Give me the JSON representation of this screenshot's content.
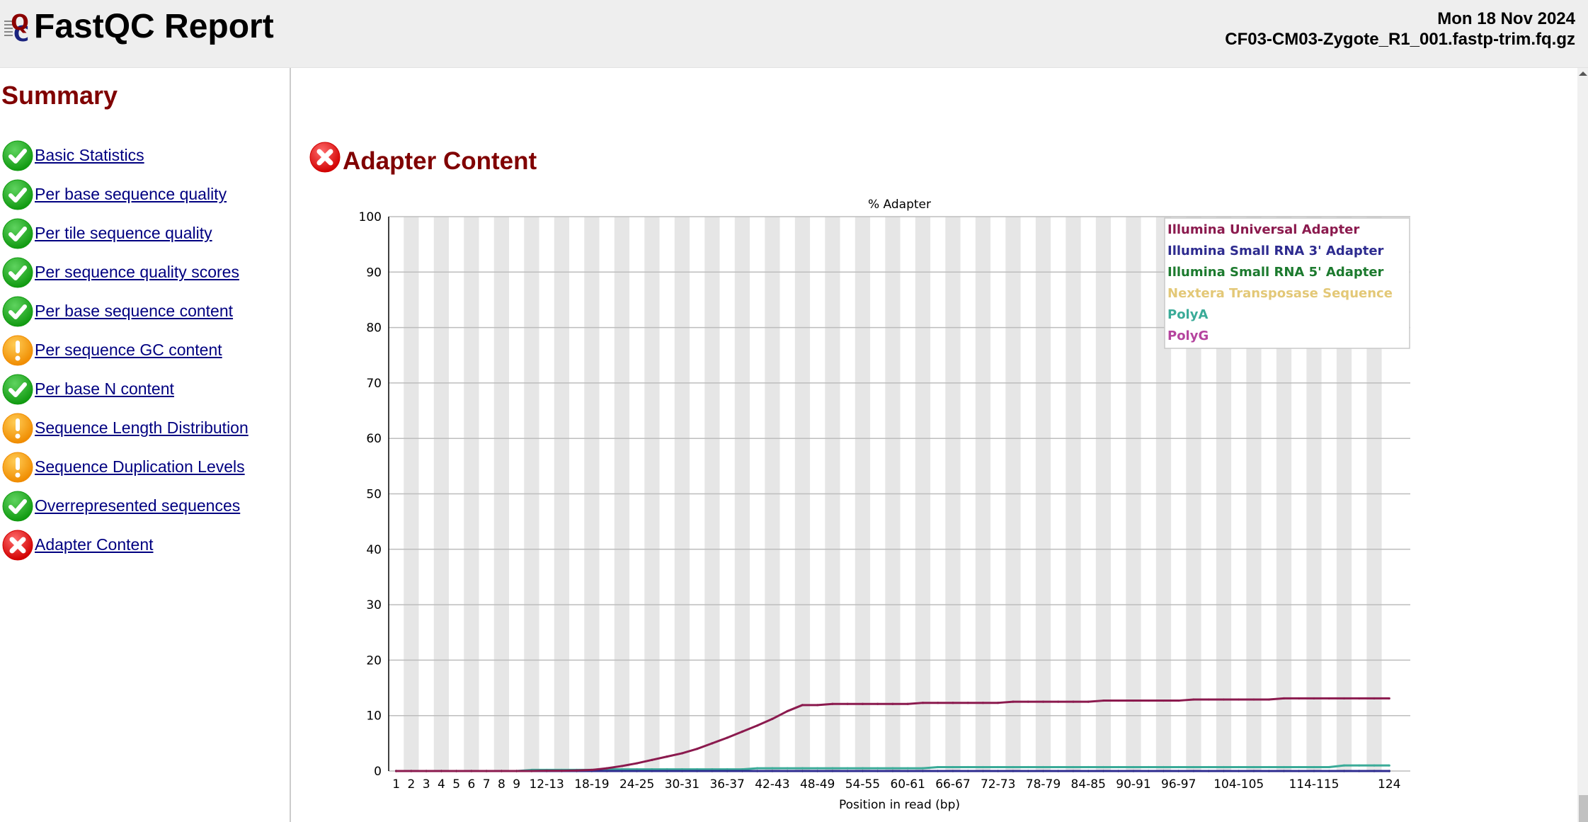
{
  "header": {
    "title": "FastQC Report",
    "date": "Mon 18 Nov 2024",
    "filename": "CF03-CM03-Zygote_R1_001.fastp-trim.fq.gz"
  },
  "sidebar": {
    "title": "Summary",
    "items": [
      {
        "label": "Basic Statistics",
        "status": "pass"
      },
      {
        "label": "Per base sequence quality",
        "status": "pass"
      },
      {
        "label": "Per tile sequence quality",
        "status": "pass"
      },
      {
        "label": "Per sequence quality scores",
        "status": "pass"
      },
      {
        "label": "Per base sequence content",
        "status": "pass"
      },
      {
        "label": "Per sequence GC content",
        "status": "warn"
      },
      {
        "label": "Per base N content",
        "status": "pass"
      },
      {
        "label": "Sequence Length Distribution",
        "status": "warn"
      },
      {
        "label": "Sequence Duplication Levels",
        "status": "warn"
      },
      {
        "label": "Overrepresented sequences",
        "status": "pass"
      },
      {
        "label": "Adapter Content",
        "status": "fail"
      }
    ]
  },
  "section": {
    "title": "Adapter Content",
    "status": "fail"
  },
  "colors": {
    "pass": "#1a9e1a",
    "warn": "#f39c12",
    "fail": "#e01818",
    "heading": "#800000",
    "link": "#000080"
  },
  "chart_data": {
    "type": "line",
    "title": "% Adapter",
    "xlabel": "Position in read (bp)",
    "ylabel": "",
    "ylim": [
      0,
      100
    ],
    "yticks": [
      0,
      10,
      20,
      30,
      40,
      50,
      60,
      70,
      80,
      90,
      100
    ],
    "grid": true,
    "legend_position": "top-right",
    "categories": [
      "1",
      "2",
      "3",
      "4",
      "5",
      "6",
      "7",
      "8",
      "9",
      "10-11",
      "12-13",
      "14-15",
      "16-17",
      "18-19",
      "20-21",
      "22-23",
      "24-25",
      "26-27",
      "28-29",
      "30-31",
      "32-33",
      "34-35",
      "36-37",
      "38-39",
      "40-41",
      "42-43",
      "44-45",
      "46-47",
      "48-49",
      "50-51",
      "52-53",
      "54-55",
      "56-57",
      "58-59",
      "60-61",
      "62-63",
      "64-65",
      "66-67",
      "68-69",
      "70-71",
      "72-73",
      "74-75",
      "76-77",
      "78-79",
      "80-81",
      "82-83",
      "84-85",
      "86-87",
      "88-89",
      "90-91",
      "92-93",
      "94-95",
      "96-97",
      "98-99",
      "100-101",
      "102-103",
      "104-105",
      "106-107",
      "108-109",
      "110-111",
      "112-113",
      "114-115",
      "116-117",
      "118-119",
      "120-121",
      "122-123",
      "124"
    ],
    "tick_labels": {
      "0": "1",
      "1": "2",
      "2": "3",
      "3": "4",
      "4": "5",
      "5": "6",
      "6": "7",
      "7": "8",
      "8": "9",
      "10": "12-13",
      "13": "18-19",
      "16": "24-25",
      "19": "30-31",
      "22": "36-37",
      "25": "42-43",
      "28": "48-49",
      "31": "54-55",
      "34": "60-61",
      "37": "66-67",
      "40": "72-73",
      "43": "78-79",
      "46": "84-85",
      "49": "90-91",
      "52": "96-97",
      "56": "104-105",
      "61": "114-115",
      "66": "124"
    },
    "series": [
      {
        "name": "Illumina Universal Adapter",
        "color": "#8b1a4e",
        "values": [
          0,
          0,
          0,
          0,
          0,
          0,
          0,
          0,
          0,
          0,
          0.05,
          0.05,
          0.1,
          0.2,
          0.5,
          0.9,
          1.4,
          2.0,
          2.6,
          3.2,
          4.0,
          5.0,
          6.0,
          7.1,
          8.2,
          9.4,
          10.8,
          11.9,
          11.9,
          12.1,
          12.1,
          12.1,
          12.1,
          12.1,
          12.1,
          12.3,
          12.3,
          12.3,
          12.3,
          12.3,
          12.3,
          12.5,
          12.5,
          12.5,
          12.5,
          12.5,
          12.5,
          12.7,
          12.7,
          12.7,
          12.7,
          12.7,
          12.7,
          12.9,
          12.9,
          12.9,
          12.9,
          12.9,
          12.9,
          13.1,
          13.1,
          13.1,
          13.1,
          13.1,
          13.1,
          13.1,
          13.1
        ]
      },
      {
        "name": "Illumina Small RNA 3' Adapter",
        "color": "#2d2b8f",
        "values": [
          0,
          0,
          0,
          0,
          0,
          0,
          0,
          0,
          0,
          0,
          0,
          0,
          0,
          0,
          0,
          0,
          0,
          0,
          0,
          0,
          0,
          0,
          0,
          0,
          0,
          0,
          0,
          0,
          0,
          0,
          0,
          0,
          0,
          0,
          0,
          0,
          0,
          0,
          0,
          0,
          0,
          0,
          0,
          0,
          0,
          0,
          0,
          0,
          0,
          0,
          0,
          0,
          0,
          0,
          0,
          0,
          0,
          0,
          0,
          0,
          0,
          0,
          0,
          0,
          0,
          0,
          0
        ]
      },
      {
        "name": "Illumina Small RNA 5' Adapter",
        "color": "#1c7a2e",
        "values": [
          0,
          0,
          0,
          0,
          0,
          0,
          0,
          0,
          0,
          0,
          0,
          0,
          0,
          0,
          0,
          0,
          0,
          0,
          0,
          0,
          0,
          0,
          0,
          0,
          0,
          0,
          0,
          0,
          0,
          0,
          0,
          0,
          0,
          0,
          0,
          0,
          0,
          0,
          0,
          0,
          0,
          0,
          0,
          0,
          0,
          0,
          0,
          0,
          0,
          0,
          0,
          0,
          0,
          0,
          0,
          0,
          0,
          0,
          0,
          0,
          0,
          0,
          0,
          0,
          0,
          0,
          0
        ]
      },
      {
        "name": "Nextera Transposase Sequence",
        "color": "#e3c877",
        "values": [
          0,
          0,
          0,
          0,
          0,
          0,
          0,
          0,
          0,
          0,
          0,
          0,
          0,
          0,
          0,
          0,
          0,
          0,
          0,
          0,
          0,
          0,
          0,
          0,
          0,
          0,
          0,
          0,
          0,
          0,
          0,
          0,
          0,
          0,
          0,
          0,
          0,
          0,
          0,
          0,
          0,
          0,
          0,
          0,
          0,
          0,
          0,
          0,
          0,
          0,
          0,
          0,
          0,
          0,
          0,
          0,
          0,
          0,
          0,
          0,
          0,
          0,
          0,
          0,
          0,
          0,
          0
        ]
      },
      {
        "name": "PolyA",
        "color": "#3aab98",
        "values": [
          0,
          0,
          0,
          0,
          0,
          0,
          0,
          0,
          0,
          0.2,
          0.2,
          0.2,
          0.2,
          0.2,
          0.3,
          0.3,
          0.3,
          0.3,
          0.3,
          0.3,
          0.3,
          0.3,
          0.3,
          0.3,
          0.5,
          0.5,
          0.5,
          0.5,
          0.5,
          0.5,
          0.5,
          0.5,
          0.5,
          0.5,
          0.5,
          0.5,
          0.7,
          0.7,
          0.7,
          0.7,
          0.7,
          0.7,
          0.7,
          0.7,
          0.7,
          0.7,
          0.7,
          0.7,
          0.7,
          0.7,
          0.7,
          0.7,
          0.7,
          0.7,
          0.7,
          0.7,
          0.7,
          0.7,
          0.7,
          0.7,
          0.7,
          0.7,
          0.7,
          1.0,
          1.0,
          1.0,
          1.0
        ]
      },
      {
        "name": "PolyG",
        "color": "#b5449e",
        "values": [
          0,
          0,
          0,
          0,
          0,
          0,
          0,
          0,
          0,
          0,
          0,
          0,
          0,
          0,
          0,
          0,
          0,
          0,
          0,
          0,
          0,
          0,
          0,
          0,
          0,
          0,
          0,
          0,
          0,
          0,
          0,
          0,
          0,
          0,
          0,
          0,
          0,
          0,
          0,
          0,
          0,
          0,
          0,
          0,
          0,
          0,
          0,
          0,
          0,
          0,
          0,
          0,
          0,
          0,
          0,
          0,
          0,
          0,
          0,
          0,
          0,
          0,
          0,
          0,
          0,
          0,
          0
        ]
      }
    ]
  }
}
